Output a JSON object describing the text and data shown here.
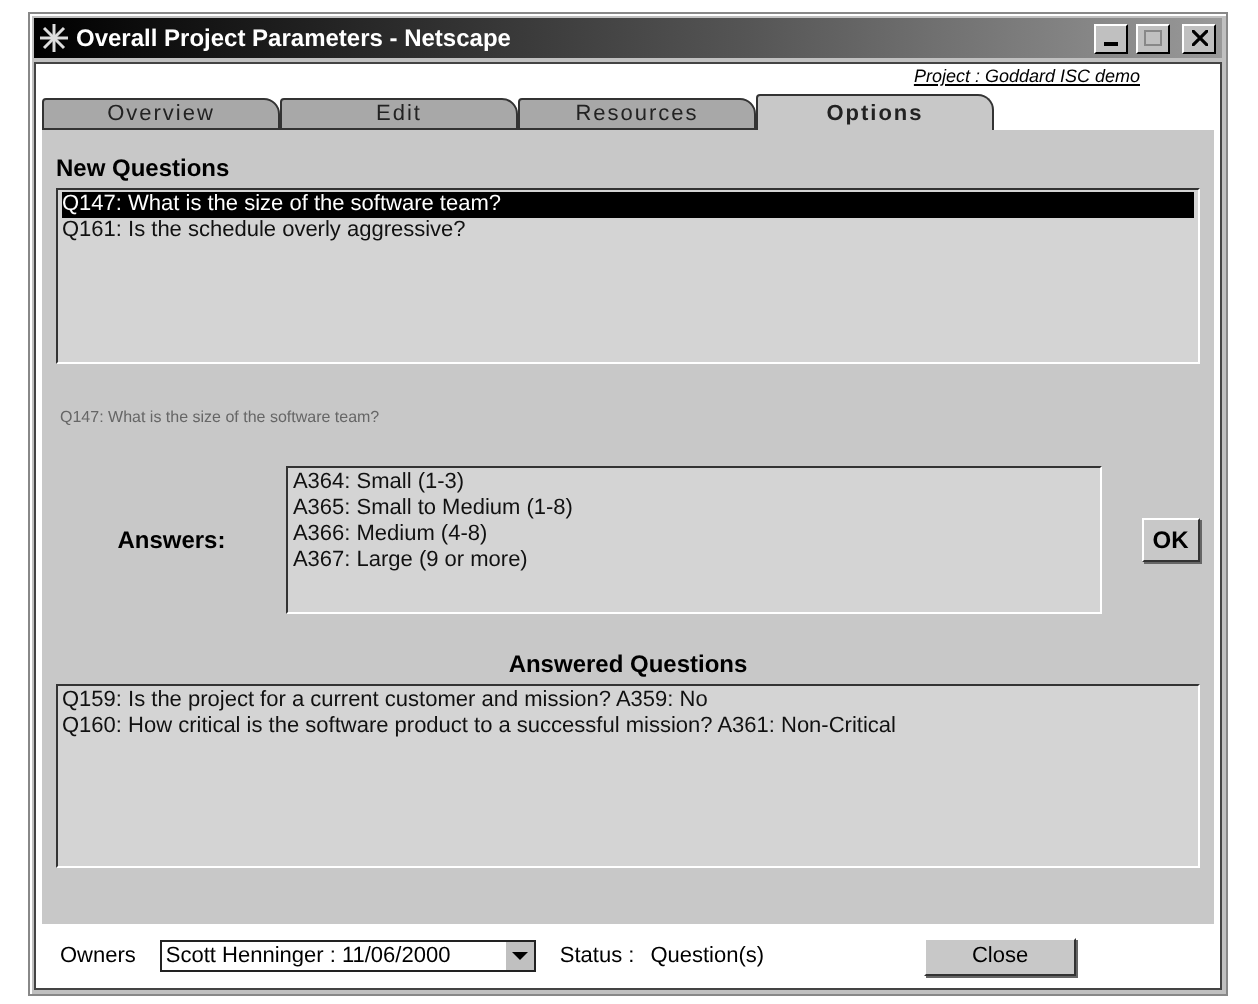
{
  "window": {
    "title": "Overall Project Parameters - Netscape"
  },
  "project_link": "Project : Goddard ISC demo",
  "tabs": [
    {
      "label": "Overview",
      "selected": false
    },
    {
      "label": "Edit",
      "selected": false
    },
    {
      "label": "Resources",
      "selected": false
    },
    {
      "label": "Options",
      "selected": true
    }
  ],
  "new_questions": {
    "heading": "New Questions",
    "items": [
      {
        "text": "Q147: What is the size of the software team?",
        "selected": true
      },
      {
        "text": "Q161: Is the schedule overly aggressive?",
        "selected": false
      }
    ]
  },
  "current_question": "Q147: What is the size of the software team?",
  "answers": {
    "label": "Answers:",
    "items": [
      "A364: Small (1-3)",
      "A365: Small to Medium (1-8)",
      "A366: Medium (4-8)",
      "A367: Large (9 or more)"
    ],
    "ok_button": "OK"
  },
  "answered_questions": {
    "heading": "Answered Questions",
    "items": [
      "Q159: Is the project for a current customer and mission? A359: No",
      "Q160: How critical is the software product to a successful mission? A361: Non-Critical"
    ]
  },
  "footer": {
    "owners_label": "Owners",
    "owner_value": "Scott Henninger : 11/06/2000",
    "status_label": "Status :",
    "status_value": "Question(s)",
    "close_button": "Close"
  }
}
